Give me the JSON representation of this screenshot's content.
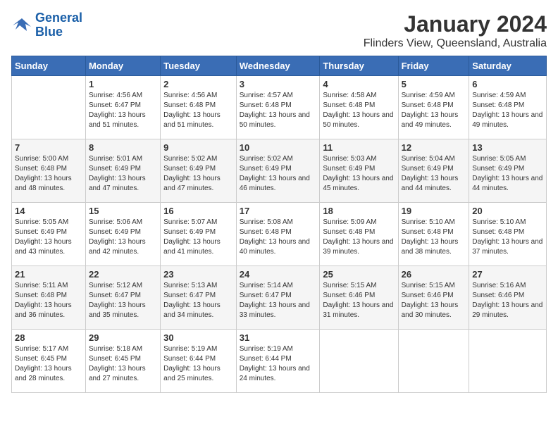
{
  "logo": {
    "line1": "General",
    "line2": "Blue"
  },
  "title": "January 2024",
  "subtitle": "Flinders View, Queensland, Australia",
  "headers": [
    "Sunday",
    "Monday",
    "Tuesday",
    "Wednesday",
    "Thursday",
    "Friday",
    "Saturday"
  ],
  "weeks": [
    [
      {
        "num": "",
        "sunrise": "",
        "sunset": "",
        "daylight": ""
      },
      {
        "num": "1",
        "sunrise": "Sunrise: 4:56 AM",
        "sunset": "Sunset: 6:47 PM",
        "daylight": "Daylight: 13 hours and 51 minutes."
      },
      {
        "num": "2",
        "sunrise": "Sunrise: 4:56 AM",
        "sunset": "Sunset: 6:48 PM",
        "daylight": "Daylight: 13 hours and 51 minutes."
      },
      {
        "num": "3",
        "sunrise": "Sunrise: 4:57 AM",
        "sunset": "Sunset: 6:48 PM",
        "daylight": "Daylight: 13 hours and 50 minutes."
      },
      {
        "num": "4",
        "sunrise": "Sunrise: 4:58 AM",
        "sunset": "Sunset: 6:48 PM",
        "daylight": "Daylight: 13 hours and 50 minutes."
      },
      {
        "num": "5",
        "sunrise": "Sunrise: 4:59 AM",
        "sunset": "Sunset: 6:48 PM",
        "daylight": "Daylight: 13 hours and 49 minutes."
      },
      {
        "num": "6",
        "sunrise": "Sunrise: 4:59 AM",
        "sunset": "Sunset: 6:48 PM",
        "daylight": "Daylight: 13 hours and 49 minutes."
      }
    ],
    [
      {
        "num": "7",
        "sunrise": "Sunrise: 5:00 AM",
        "sunset": "Sunset: 6:48 PM",
        "daylight": "Daylight: 13 hours and 48 minutes."
      },
      {
        "num": "8",
        "sunrise": "Sunrise: 5:01 AM",
        "sunset": "Sunset: 6:49 PM",
        "daylight": "Daylight: 13 hours and 47 minutes."
      },
      {
        "num": "9",
        "sunrise": "Sunrise: 5:02 AM",
        "sunset": "Sunset: 6:49 PM",
        "daylight": "Daylight: 13 hours and 47 minutes."
      },
      {
        "num": "10",
        "sunrise": "Sunrise: 5:02 AM",
        "sunset": "Sunset: 6:49 PM",
        "daylight": "Daylight: 13 hours and 46 minutes."
      },
      {
        "num": "11",
        "sunrise": "Sunrise: 5:03 AM",
        "sunset": "Sunset: 6:49 PM",
        "daylight": "Daylight: 13 hours and 45 minutes."
      },
      {
        "num": "12",
        "sunrise": "Sunrise: 5:04 AM",
        "sunset": "Sunset: 6:49 PM",
        "daylight": "Daylight: 13 hours and 44 minutes."
      },
      {
        "num": "13",
        "sunrise": "Sunrise: 5:05 AM",
        "sunset": "Sunset: 6:49 PM",
        "daylight": "Daylight: 13 hours and 44 minutes."
      }
    ],
    [
      {
        "num": "14",
        "sunrise": "Sunrise: 5:05 AM",
        "sunset": "Sunset: 6:49 PM",
        "daylight": "Daylight: 13 hours and 43 minutes."
      },
      {
        "num": "15",
        "sunrise": "Sunrise: 5:06 AM",
        "sunset": "Sunset: 6:49 PM",
        "daylight": "Daylight: 13 hours and 42 minutes."
      },
      {
        "num": "16",
        "sunrise": "Sunrise: 5:07 AM",
        "sunset": "Sunset: 6:49 PM",
        "daylight": "Daylight: 13 hours and 41 minutes."
      },
      {
        "num": "17",
        "sunrise": "Sunrise: 5:08 AM",
        "sunset": "Sunset: 6:48 PM",
        "daylight": "Daylight: 13 hours and 40 minutes."
      },
      {
        "num": "18",
        "sunrise": "Sunrise: 5:09 AM",
        "sunset": "Sunset: 6:48 PM",
        "daylight": "Daylight: 13 hours and 39 minutes."
      },
      {
        "num": "19",
        "sunrise": "Sunrise: 5:10 AM",
        "sunset": "Sunset: 6:48 PM",
        "daylight": "Daylight: 13 hours and 38 minutes."
      },
      {
        "num": "20",
        "sunrise": "Sunrise: 5:10 AM",
        "sunset": "Sunset: 6:48 PM",
        "daylight": "Daylight: 13 hours and 37 minutes."
      }
    ],
    [
      {
        "num": "21",
        "sunrise": "Sunrise: 5:11 AM",
        "sunset": "Sunset: 6:48 PM",
        "daylight": "Daylight: 13 hours and 36 minutes."
      },
      {
        "num": "22",
        "sunrise": "Sunrise: 5:12 AM",
        "sunset": "Sunset: 6:47 PM",
        "daylight": "Daylight: 13 hours and 35 minutes."
      },
      {
        "num": "23",
        "sunrise": "Sunrise: 5:13 AM",
        "sunset": "Sunset: 6:47 PM",
        "daylight": "Daylight: 13 hours and 34 minutes."
      },
      {
        "num": "24",
        "sunrise": "Sunrise: 5:14 AM",
        "sunset": "Sunset: 6:47 PM",
        "daylight": "Daylight: 13 hours and 33 minutes."
      },
      {
        "num": "25",
        "sunrise": "Sunrise: 5:15 AM",
        "sunset": "Sunset: 6:46 PM",
        "daylight": "Daylight: 13 hours and 31 minutes."
      },
      {
        "num": "26",
        "sunrise": "Sunrise: 5:15 AM",
        "sunset": "Sunset: 6:46 PM",
        "daylight": "Daylight: 13 hours and 30 minutes."
      },
      {
        "num": "27",
        "sunrise": "Sunrise: 5:16 AM",
        "sunset": "Sunset: 6:46 PM",
        "daylight": "Daylight: 13 hours and 29 minutes."
      }
    ],
    [
      {
        "num": "28",
        "sunrise": "Sunrise: 5:17 AM",
        "sunset": "Sunset: 6:45 PM",
        "daylight": "Daylight: 13 hours and 28 minutes."
      },
      {
        "num": "29",
        "sunrise": "Sunrise: 5:18 AM",
        "sunset": "Sunset: 6:45 PM",
        "daylight": "Daylight: 13 hours and 27 minutes."
      },
      {
        "num": "30",
        "sunrise": "Sunrise: 5:19 AM",
        "sunset": "Sunset: 6:44 PM",
        "daylight": "Daylight: 13 hours and 25 minutes."
      },
      {
        "num": "31",
        "sunrise": "Sunrise: 5:19 AM",
        "sunset": "Sunset: 6:44 PM",
        "daylight": "Daylight: 13 hours and 24 minutes."
      },
      {
        "num": "",
        "sunrise": "",
        "sunset": "",
        "daylight": ""
      },
      {
        "num": "",
        "sunrise": "",
        "sunset": "",
        "daylight": ""
      },
      {
        "num": "",
        "sunrise": "",
        "sunset": "",
        "daylight": ""
      }
    ]
  ]
}
